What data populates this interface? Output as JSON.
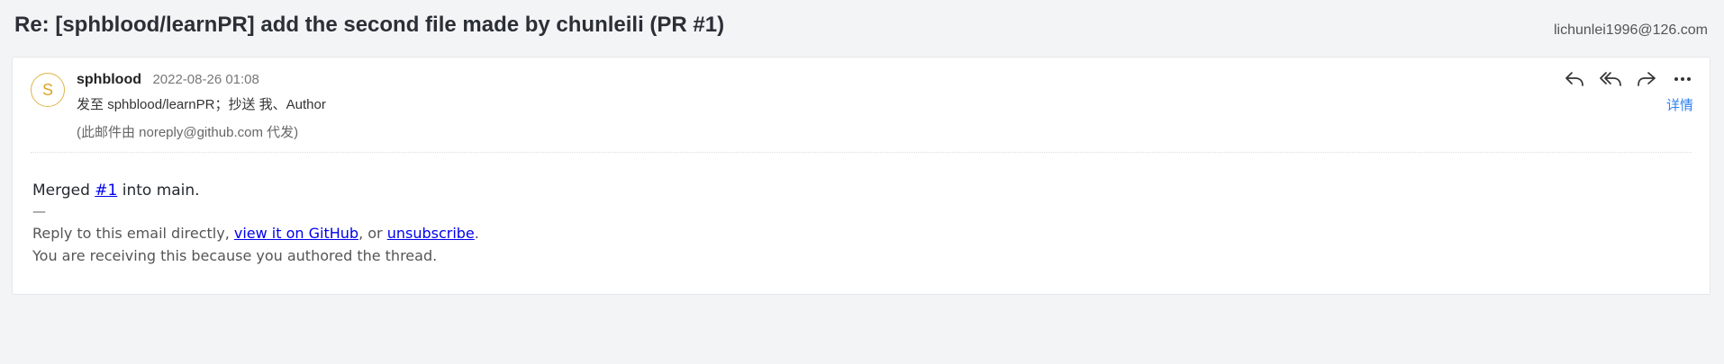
{
  "header": {
    "subject": "Re: [sphblood/learnPR] add the second file made by chunleili (PR #1)",
    "account": "lichunlei1996@126.com"
  },
  "message": {
    "avatar_letter": "S",
    "sender": "sphblood",
    "date": "2022-08-26 01:08",
    "to_prefix": "发至",
    "to": "sphblood/learnPR",
    "cc_prefix": "；抄送",
    "cc_me": "我",
    "cc_sep": "、",
    "cc_other": "Author",
    "proxy_note": "(此邮件由 noreply@github.com 代发)",
    "details_link": "详情",
    "actions": [
      {
        "name": "reply",
        "icon": "reply-icon"
      },
      {
        "name": "reply-all",
        "icon": "reply-all-icon"
      },
      {
        "name": "forward",
        "icon": "forward-icon"
      },
      {
        "name": "more",
        "icon": "more-icon"
      }
    ]
  },
  "body": {
    "merged_prefix": "Merged ",
    "merged_link": "#1",
    "merged_suffix": " into main.",
    "dash": "—",
    "reply_prefix": "Reply to this email directly, ",
    "reply_link1": "view it on GitHub",
    "reply_mid": ", or ",
    "reply_link2": "unsubscribe",
    "reply_suffix": ".",
    "receiving_note": "You are receiving this because you authored the thread."
  },
  "colors": {
    "page_bg": "#f3f4f6",
    "card_bg": "#ffffff",
    "link": "#0000ee",
    "accent": "#2f80ed",
    "avatar_ring": "#e0b54a"
  }
}
